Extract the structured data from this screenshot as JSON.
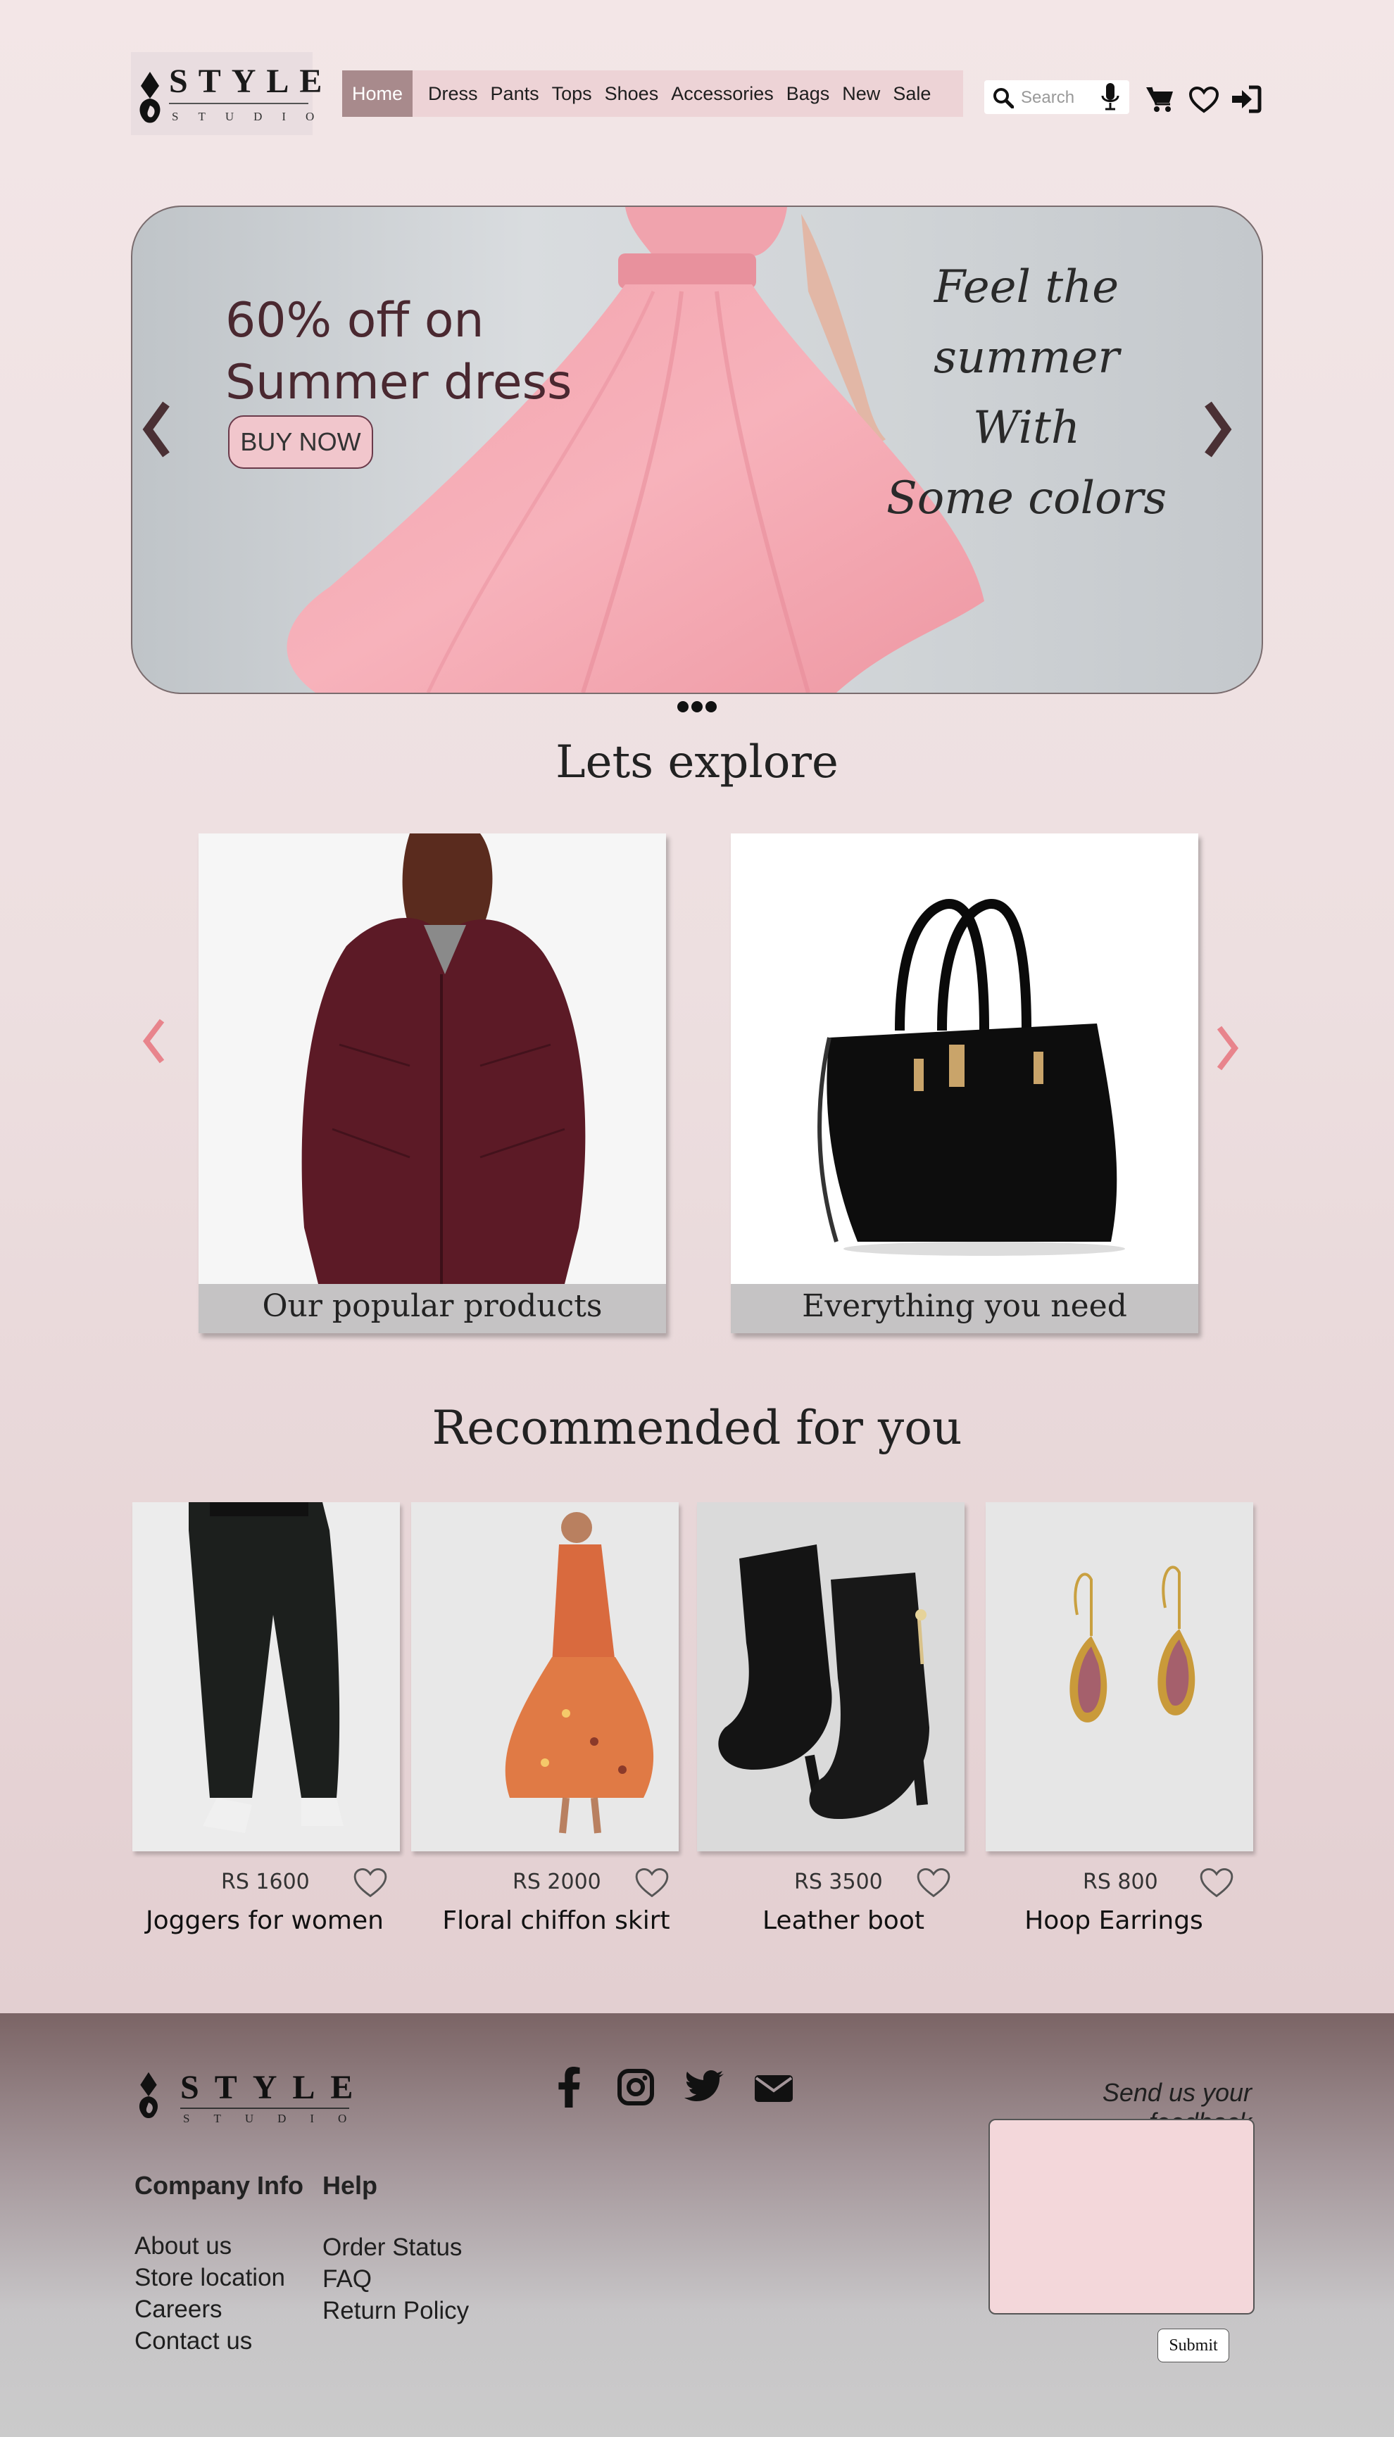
{
  "brand": {
    "name": "STYLE",
    "sub": "STUDIO"
  },
  "nav": {
    "items": [
      {
        "label": "Home",
        "active": true
      },
      {
        "label": "Dress"
      },
      {
        "label": "Pants"
      },
      {
        "label": "Tops"
      },
      {
        "label": "Shoes"
      },
      {
        "label": "Accessories"
      },
      {
        "label": "Bags"
      },
      {
        "label": "New"
      },
      {
        "label": "Sale"
      }
    ]
  },
  "search": {
    "placeholder": "Search",
    "icons": [
      "search-icon",
      "microphone-icon",
      "cart-icon",
      "heart-icon",
      "sign-in-icon"
    ]
  },
  "hero": {
    "title_line1": "60% off on",
    "title_line2": "Summer dress",
    "button": "BUY NOW",
    "script_line1": "Feel the summer",
    "script_line2": "With",
    "script_line3": "Some colors",
    "slides": 3
  },
  "explore": {
    "title": "Lets explore",
    "cards": [
      {
        "caption": "Our popular products"
      },
      {
        "caption": "Everything you need"
      }
    ]
  },
  "recommended": {
    "title": "Recommended for you",
    "products": [
      {
        "price": "RS 1600",
        "name": "Joggers for women"
      },
      {
        "price": "RS 2000",
        "name": "Floral chiffon skirt"
      },
      {
        "price": "RS 3500",
        "name": "Leather boot"
      },
      {
        "price": "RS 800",
        "name": "Hoop Earrings"
      }
    ]
  },
  "footer": {
    "company_info": {
      "heading": "Company Info",
      "links": [
        "About us",
        "Store location",
        "Careers",
        "Contact us"
      ]
    },
    "help": {
      "heading": "Help",
      "links": [
        "Order Status",
        "FAQ",
        "Return Policy"
      ]
    },
    "social": [
      "facebook-icon",
      "instagram-icon",
      "twitter-icon",
      "email-icon"
    ],
    "feedback_label": "Send us your feedback",
    "submit": "Submit"
  },
  "colors": {
    "accent": "#a88a8c",
    "nav_bg": "#edd3d6",
    "button_pink": "#f1c6cc",
    "arrow_pink": "#e8848c"
  }
}
